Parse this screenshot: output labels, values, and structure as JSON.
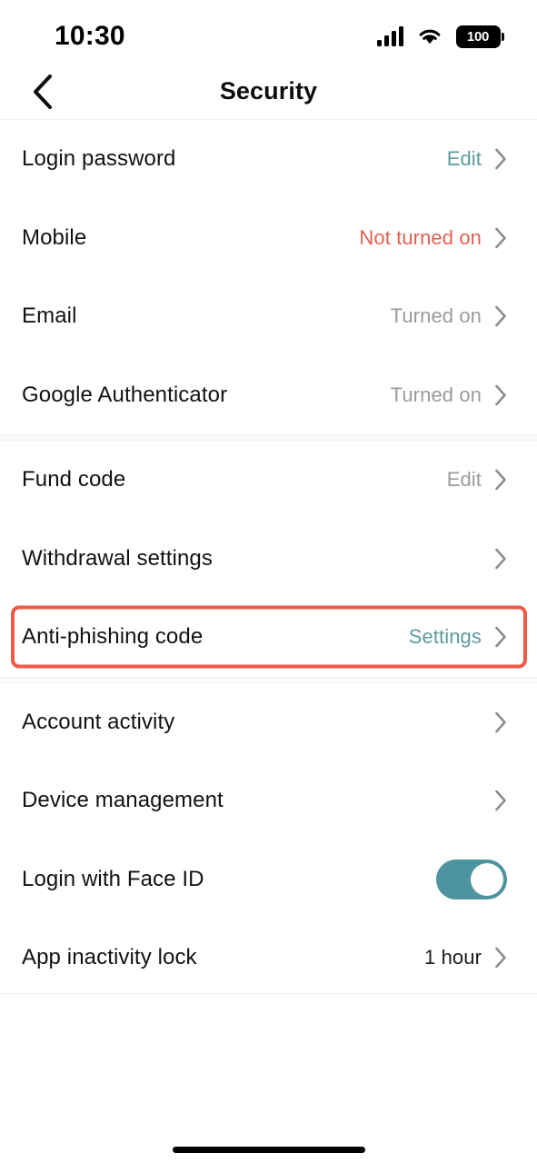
{
  "status_bar": {
    "time": "10:30",
    "signal_icon": "cellular-signal-icon",
    "wifi_icon": "wifi-icon",
    "battery_level": "100",
    "battery_icon": "battery-full-icon"
  },
  "header": {
    "back_icon": "chevron-left-icon",
    "title": "Security"
  },
  "colors": {
    "accent_teal": "#5c9ba0",
    "danger_red": "#e2604f",
    "muted_gray": "#9b9b9b",
    "highlight_red": "#ee5a4a",
    "toggle_on": "#4e93a0"
  },
  "sections": [
    {
      "rows": [
        {
          "title": "Login password",
          "value": "Edit",
          "value_style": "accent",
          "control": "chevron",
          "chevron_icon": "chevron-right-icon",
          "highlighted": false
        },
        {
          "title": "Mobile",
          "value": "Not turned on",
          "value_style": "danger",
          "control": "chevron",
          "chevron_icon": "chevron-right-icon",
          "highlighted": false
        },
        {
          "title": "Email",
          "value": "Turned on",
          "value_style": "muted",
          "control": "chevron",
          "chevron_icon": "chevron-right-icon",
          "highlighted": false
        },
        {
          "title": "Google Authenticator",
          "value": "Turned on",
          "value_style": "muted",
          "control": "chevron",
          "chevron_icon": "chevron-right-icon",
          "highlighted": false
        }
      ]
    },
    {
      "rows": [
        {
          "title": "Fund code",
          "value": "Edit",
          "value_style": "muted",
          "control": "chevron",
          "chevron_icon": "chevron-right-icon",
          "highlighted": false
        },
        {
          "title": "Withdrawal settings",
          "value": "",
          "value_style": "muted",
          "control": "chevron",
          "chevron_icon": "chevron-right-icon",
          "highlighted": false
        },
        {
          "title": "Anti-phishing code",
          "value": "Settings",
          "value_style": "accent",
          "control": "chevron",
          "chevron_icon": "chevron-right-icon",
          "highlighted": true
        }
      ]
    },
    {
      "rows": [
        {
          "title": "Account activity",
          "value": "",
          "value_style": "muted",
          "control": "chevron",
          "chevron_icon": "chevron-right-icon",
          "highlighted": false
        },
        {
          "title": "Device management",
          "value": "",
          "value_style": "muted",
          "control": "chevron",
          "chevron_icon": "chevron-right-icon",
          "highlighted": false
        },
        {
          "title": "Login with Face ID",
          "value": "",
          "value_style": "muted",
          "control": "toggle",
          "toggle_on": true,
          "highlighted": false
        },
        {
          "title": "App inactivity lock",
          "value": "1 hour",
          "value_style": "dark",
          "control": "chevron",
          "chevron_icon": "chevron-right-icon",
          "highlighted": false
        }
      ]
    }
  ],
  "home_indicator": "home-indicator-bar"
}
